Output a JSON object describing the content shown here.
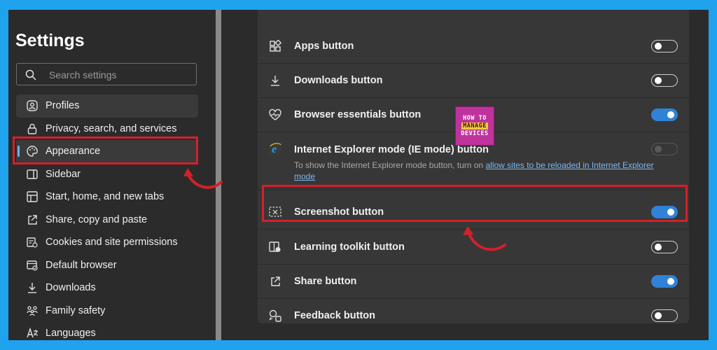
{
  "sidebar": {
    "title": "Settings",
    "search_placeholder": "Search settings",
    "items": [
      {
        "label": "Profiles",
        "icon": "profile-icon"
      },
      {
        "label": "Privacy, search, and services",
        "icon": "lock-icon"
      },
      {
        "label": "Appearance",
        "icon": "palette-icon",
        "selected": true
      },
      {
        "label": "Sidebar",
        "icon": "sidebar-icon"
      },
      {
        "label": "Start, home, and new tabs",
        "icon": "home-icon"
      },
      {
        "label": "Share, copy and paste",
        "icon": "share-icon"
      },
      {
        "label": "Cookies and site permissions",
        "icon": "cookies-icon"
      },
      {
        "label": "Default browser",
        "icon": "browser-icon"
      },
      {
        "label": "Downloads",
        "icon": "download-icon"
      },
      {
        "label": "Family safety",
        "icon": "family-icon"
      },
      {
        "label": "Languages",
        "icon": "languages-icon"
      }
    ]
  },
  "toolbar_buttons": [
    {
      "label": "Apps button",
      "icon": "apps-icon",
      "state": "off"
    },
    {
      "label": "Downloads button",
      "icon": "download-icon",
      "state": "off"
    },
    {
      "label": "Browser essentials button",
      "icon": "heart-pulse-icon",
      "state": "on"
    },
    {
      "label": "Internet Explorer mode (IE mode) button",
      "icon": "ie-icon",
      "state": "disabled"
    },
    {
      "label": "Screenshot button",
      "icon": "screenshot-icon",
      "state": "on"
    },
    {
      "label": "Learning toolkit button",
      "icon": "learning-toolkit-icon",
      "state": "off"
    },
    {
      "label": "Share button",
      "icon": "share-icon",
      "state": "on"
    },
    {
      "label": "Feedback button",
      "icon": "feedback-icon",
      "state": "off"
    }
  ],
  "ie_note": {
    "text": "To show the Internet Explorer mode button, turn on ",
    "link": "allow sites to be reloaded in Internet Explorer mode"
  },
  "watermark": {
    "line1": "HOW TO",
    "line2": "MANAGE",
    "line3": "DEVICES"
  },
  "colors": {
    "background": "#1fa3ee",
    "toggle_on": "#2f82d7",
    "highlight": "#d3202a",
    "link": "#7db7f0"
  }
}
